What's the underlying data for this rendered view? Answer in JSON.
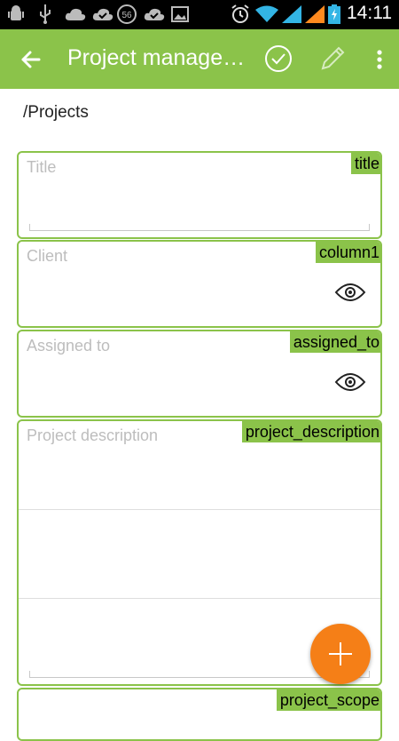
{
  "statusbar": {
    "time": "14:11",
    "notification_badge": "56",
    "icons": [
      "android-debug-icon",
      "usb-icon",
      "cloud-upload-icon",
      "cloud-done-icon",
      "sync-badge-icon",
      "cloud-done-icon",
      "image-icon",
      "alarm-icon",
      "wifi-icon",
      "signal-icon",
      "signal-icon",
      "battery-charging-icon"
    ]
  },
  "appbar": {
    "title": "Project management",
    "back_icon": "arrow-left-icon",
    "save_icon": "check-circle-icon",
    "edit_icon": "pencil-icon",
    "menu_icon": "more-vert-icon"
  },
  "breadcrumb": "/Projects",
  "form": {
    "fields": [
      {
        "placeholder": "Title",
        "tag": "title"
      },
      {
        "placeholder": "Client",
        "tag": "column1",
        "icon": "eye-icon"
      },
      {
        "placeholder": "Assigned to",
        "tag": "assigned_to",
        "icon": "eye-icon"
      },
      {
        "placeholder": "Project description",
        "tag": "project_description"
      },
      {
        "placeholder": "",
        "tag": "project_scope"
      }
    ]
  },
  "fab": {
    "icon": "plus-icon"
  },
  "colors": {
    "primary": "#8bc34a",
    "accent": "#f57f17",
    "statusbar": "#000000",
    "placeholder": "#bdbdbd"
  }
}
